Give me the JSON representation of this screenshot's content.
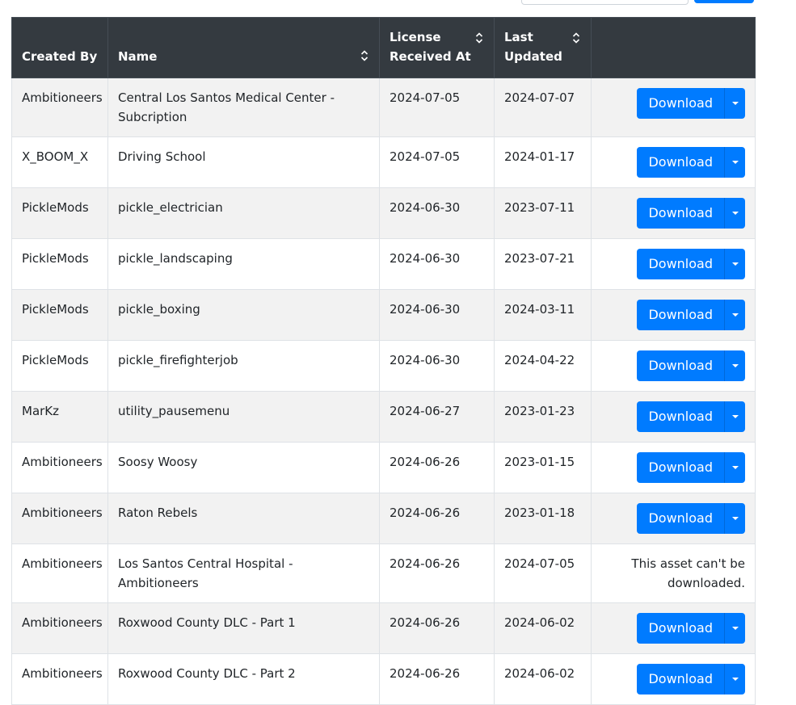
{
  "table": {
    "headers": {
      "created_by": "Created By",
      "name": "Name",
      "license_received_line1": "License",
      "license_received_line2": "Received At",
      "last_updated_line1": "Last",
      "last_updated_line2": "Updated"
    },
    "download_label": "Download",
    "no_download_line1": "This asset can't be",
    "no_download_line2": "downloaded.",
    "rows": [
      {
        "created_by": "Ambitioneers",
        "name": "Central Los Santos Medical Center - Subcription",
        "license_received": "2024-07-05",
        "last_updated": "2024-07-07"
      },
      {
        "created_by": "X_BOOM_X",
        "name": "Driving School",
        "license_received": "2024-07-05",
        "last_updated": "2024-01-17"
      },
      {
        "created_by": "PickleMods",
        "name": "pickle_electrician",
        "license_received": "2024-06-30",
        "last_updated": "2023-07-11"
      },
      {
        "created_by": "PickleMods",
        "name": "pickle_landscaping",
        "license_received": "2024-06-30",
        "last_updated": "2023-07-21"
      },
      {
        "created_by": "PickleMods",
        "name": "pickle_boxing",
        "license_received": "2024-06-30",
        "last_updated": "2024-03-11"
      },
      {
        "created_by": "PickleMods",
        "name": "pickle_firefighterjob",
        "license_received": "2024-06-30",
        "last_updated": "2024-04-22"
      },
      {
        "created_by": "MarKz",
        "name": "utility_pausemenu",
        "license_received": "2024-06-27",
        "last_updated": "2023-01-23"
      },
      {
        "created_by": "Ambitioneers",
        "name": "Soosy Woosy",
        "license_received": "2024-06-26",
        "last_updated": "2023-01-15"
      },
      {
        "created_by": "Ambitioneers",
        "name": "Raton Rebels",
        "license_received": "2024-06-26",
        "last_updated": "2023-01-18"
      },
      {
        "created_by": "Ambitioneers",
        "name": "Los Santos Central Hospital - Ambitioneers",
        "license_received": "2024-06-26",
        "last_updated": "2024-07-05"
      },
      {
        "created_by": "Ambitioneers",
        "name": "Roxwood County DLC - Part 1",
        "license_received": "2024-06-26",
        "last_updated": "2024-06-02"
      },
      {
        "created_by": "Ambitioneers",
        "name": "Roxwood County DLC - Part 2",
        "license_received": "2024-06-26",
        "last_updated": "2024-06-02"
      }
    ]
  },
  "colors": {
    "header_bg": "#343a40",
    "primary_button": "#007bff",
    "stripe": "#f2f2f2"
  },
  "icons": {
    "sort": "sort-icon",
    "dropdown": "chevron-down-icon"
  }
}
